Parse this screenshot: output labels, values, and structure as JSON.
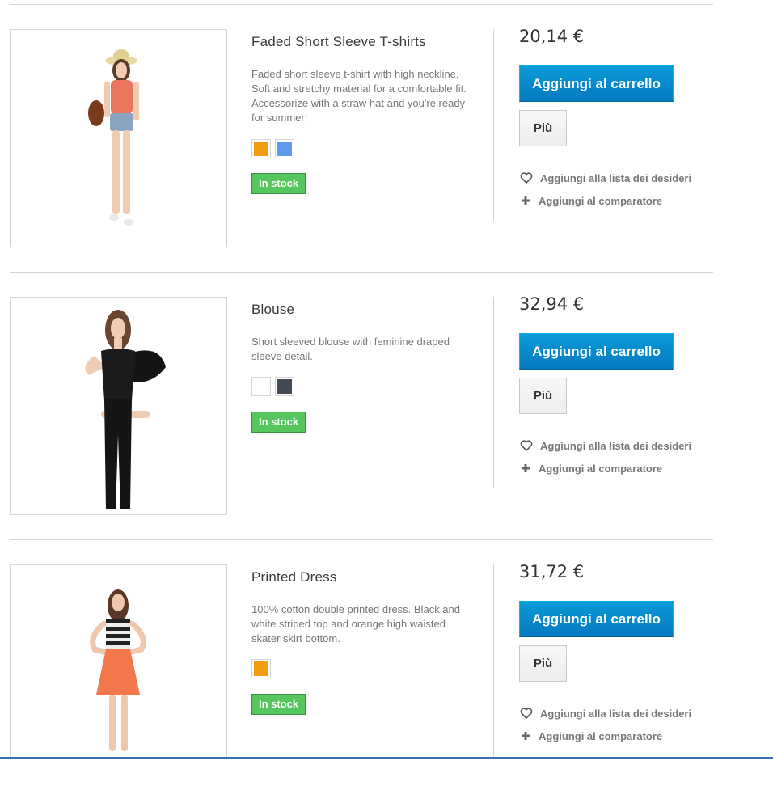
{
  "products": [
    {
      "name": "Faded Short Sleeve T-shirts",
      "description": "Faded short sleeve t-shirt with high neckline. Soft and stretchy material for a comfortable fit. Accessorize with a straw hat and you're ready for summer!",
      "colors": [
        "#f39c11",
        "#5d9cec"
      ],
      "stock": "In stock",
      "price": "20,14 €",
      "cart_label": "Aggiungi al carrello",
      "more_label": "Più",
      "wishlist_label": "Aggiungi alla lista dei desideri",
      "compare_label": "Aggiungi al comparatore"
    },
    {
      "name": "Blouse",
      "description": "Short sleeved blouse with feminine draped sleeve detail.",
      "colors": [
        "#ffffff",
        "#434a54"
      ],
      "stock": "In stock",
      "price": "32,94 €",
      "cart_label": "Aggiungi al carrello",
      "more_label": "Più",
      "wishlist_label": "Aggiungi alla lista dei desideri",
      "compare_label": "Aggiungi al comparatore"
    },
    {
      "name": "Printed Dress",
      "description": "100% cotton double printed dress. Black and white striped top and orange high waisted skater skirt bottom.",
      "colors": [
        "#f39c11"
      ],
      "stock": "In stock",
      "price": "31,72 €",
      "cart_label": "Aggiungi al carrello",
      "more_label": "Più",
      "wishlist_label": "Aggiungi alla lista dei desideri",
      "compare_label": "Aggiungi al comparatore"
    }
  ],
  "icons": {
    "wishlist": "heart-icon",
    "compare": "plus-icon"
  },
  "accent": {
    "cart_button": "#0a9ad8",
    "stock_badge": "#55c65e"
  }
}
